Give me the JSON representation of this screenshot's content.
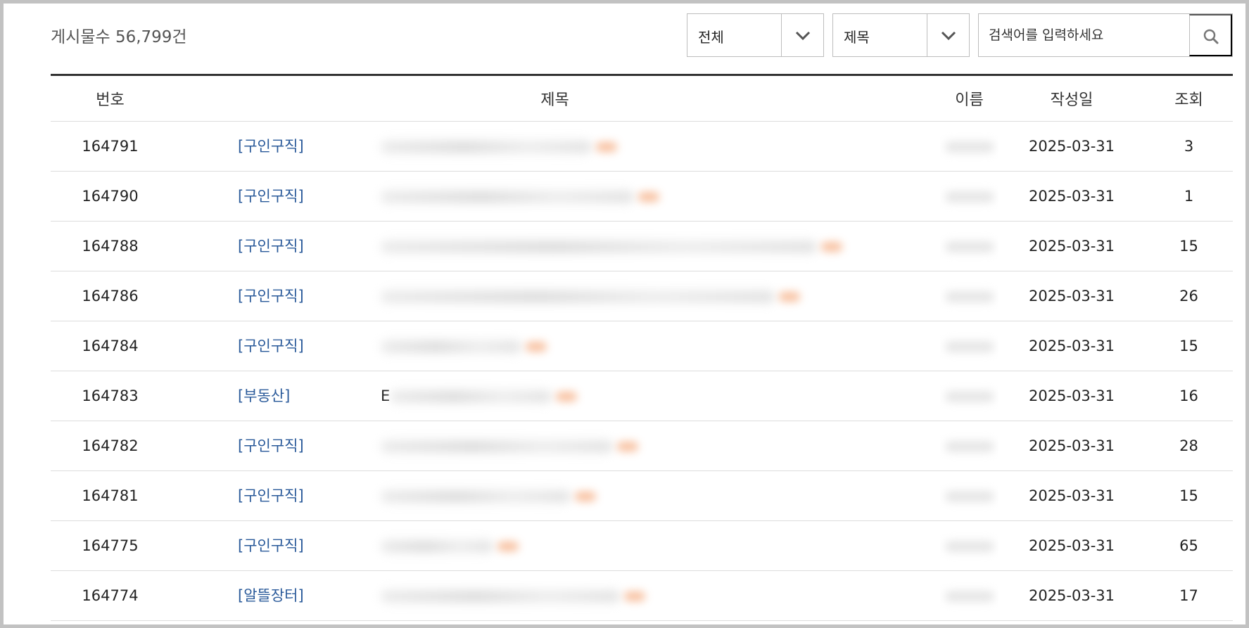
{
  "header": {
    "post_count_label": "게시물수",
    "post_count_value": "56,799건"
  },
  "filters": {
    "category_select": {
      "selected": "전체"
    },
    "field_select": {
      "selected": "제목"
    },
    "search": {
      "placeholder": "검색어를 입력하세요",
      "value": "",
      "button_icon": "search-icon"
    }
  },
  "table": {
    "columns": [
      "번호",
      "제목",
      "이름",
      "작성일",
      "조회"
    ],
    "rows": [
      {
        "number": "164791",
        "category": "[구인구직]",
        "title_visible": "",
        "date": "2025-03-31",
        "views": "3"
      },
      {
        "number": "164790",
        "category": "[구인구직]",
        "title_visible": "",
        "date": "2025-03-31",
        "views": "1"
      },
      {
        "number": "164788",
        "category": "[구인구직]",
        "title_visible": "",
        "date": "2025-03-31",
        "views": "15"
      },
      {
        "number": "164786",
        "category": "[구인구직]",
        "title_visible": "",
        "date": "2025-03-31",
        "views": "26"
      },
      {
        "number": "164784",
        "category": "[구인구직]",
        "title_visible": "",
        "date": "2025-03-31",
        "views": "15"
      },
      {
        "number": "164783",
        "category": "[부동산]",
        "title_visible": "E",
        "date": "2025-03-31",
        "views": "16"
      },
      {
        "number": "164782",
        "category": "[구인구직]",
        "title_visible": "",
        "date": "2025-03-31",
        "views": "28"
      },
      {
        "number": "164781",
        "category": "[구인구직]",
        "title_visible": "",
        "date": "2025-03-31",
        "views": "15"
      },
      {
        "number": "164775",
        "category": "[구인구직]",
        "title_visible": "",
        "date": "2025-03-31",
        "views": "65"
      },
      {
        "number": "164774",
        "category": "[알뜰장터]",
        "title_visible": "",
        "date": "2025-03-31",
        "views": "17"
      }
    ]
  },
  "colors": {
    "category_link": "#2a5a9a",
    "table_top_border": "#333333",
    "row_border": "#dcdcdc",
    "frame_border": "#c2c2c2"
  }
}
